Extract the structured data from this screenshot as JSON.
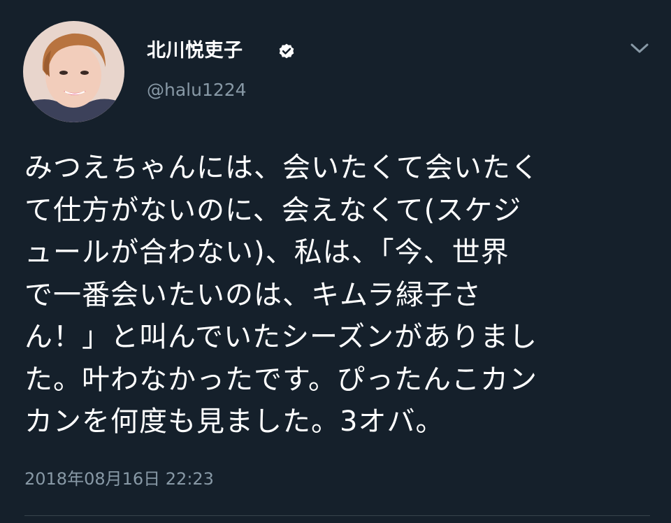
{
  "author": {
    "name": "北川悦吏子",
    "handle": "@halu1224",
    "verified": true,
    "avatar_icon": "avatar-photo"
  },
  "tweet": {
    "lines": [
      "みつえちゃんには、会いたくて会いたく",
      "て仕方がないのに、会えなくて(スケジ",
      "ュールが合わない)、私は、「今、世界",
      "で一番会いたいのは、キムラ緑子さ",
      "ん！」と叫んでいたシーズンがありまし",
      "た。叶わなかったです。ぴったんこカン",
      "カンを何度も見ました。3オバ。"
    ]
  },
  "timestamp": "2018年08月16日 22:23",
  "icons": {
    "verified": "verified-badge-icon",
    "more": "chevron-down-icon"
  },
  "colors": {
    "background": "#15202b",
    "primary_text": "#ffffff",
    "secondary_text": "#8899a6",
    "divider": "#38444d"
  }
}
